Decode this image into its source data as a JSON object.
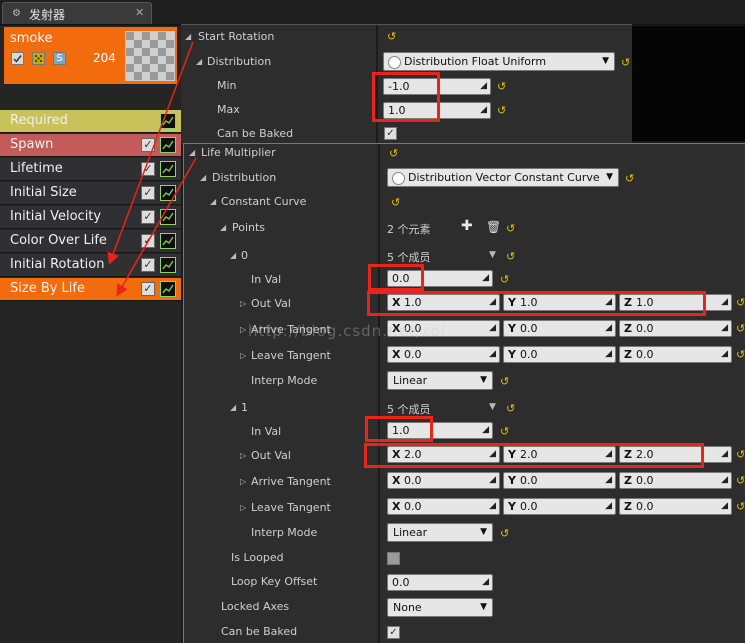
{
  "tab": {
    "title": "发射器",
    "close": "✕",
    "icon": "gear-icon"
  },
  "emitter": {
    "name": "smoke",
    "count": "204",
    "solo_label": "S"
  },
  "modules": [
    {
      "label": "Required",
      "color": "#c9c25b",
      "checkbox": false
    },
    {
      "label": "Spawn",
      "color": "#c45b5b",
      "checkbox": true
    },
    {
      "label": "Lifetime",
      "color": "#303032",
      "checkbox": true
    },
    {
      "label": "Initial Size",
      "color": "#303032",
      "checkbox": true
    },
    {
      "label": "Initial Velocity",
      "color": "#303032",
      "checkbox": true
    },
    {
      "label": "Color Over Life",
      "color": "#303032",
      "checkbox": true
    },
    {
      "label": "Initial Rotation",
      "color": "#303032",
      "checkbox": true
    },
    {
      "label": "Size By Life",
      "color": "#f26b0d",
      "checkbox": true
    }
  ],
  "start_rotation": {
    "header": "Start Rotation",
    "distribution_label": "Distribution",
    "distribution_value": "Distribution Float Uniform",
    "min_label": "Min",
    "min_value": "-1.0",
    "max_label": "Max",
    "max_value": "1.0",
    "baked_label": "Can be Baked"
  },
  "life_multiplier": {
    "header": "Life Multiplier",
    "distribution_label": "Distribution",
    "distribution_value": "Distribution Vector Constant Curve",
    "constant_curve_label": "Constant Curve",
    "points_label": "Points",
    "points_count": "2 个元素",
    "points": [
      {
        "index": "0",
        "members": "5 个成员",
        "in_val": "0.0",
        "out_val": [
          "1.0",
          "1.0",
          "1.0"
        ],
        "arrive": [
          "0.0",
          "0.0",
          "0.0"
        ],
        "leave": [
          "0.0",
          "0.0",
          "0.0"
        ],
        "interp": "Linear"
      },
      {
        "index": "1",
        "members": "5 个成员",
        "in_val": "1.0",
        "out_val": [
          "2.0",
          "2.0",
          "2.0"
        ],
        "arrive": [
          "0.0",
          "0.0",
          "0.0"
        ],
        "leave": [
          "0.0",
          "0.0",
          "0.0"
        ],
        "interp": "Linear"
      }
    ],
    "labels": {
      "in_val": "In Val",
      "out_val": "Out Val",
      "arrive": "Arrive Tangent",
      "leave": "Leave Tangent",
      "interp": "Interp Mode",
      "x": "X",
      "y": "Y",
      "z": "Z"
    },
    "is_looped_label": "Is Looped",
    "loop_key_offset_label": "Loop Key Offset",
    "loop_key_offset_value": "0.0",
    "locked_axes_label": "Locked Axes",
    "locked_axes_value": "None",
    "baked_label": "Can be Baked"
  },
  "watermark": "http://blog.csdn.net/zol"
}
